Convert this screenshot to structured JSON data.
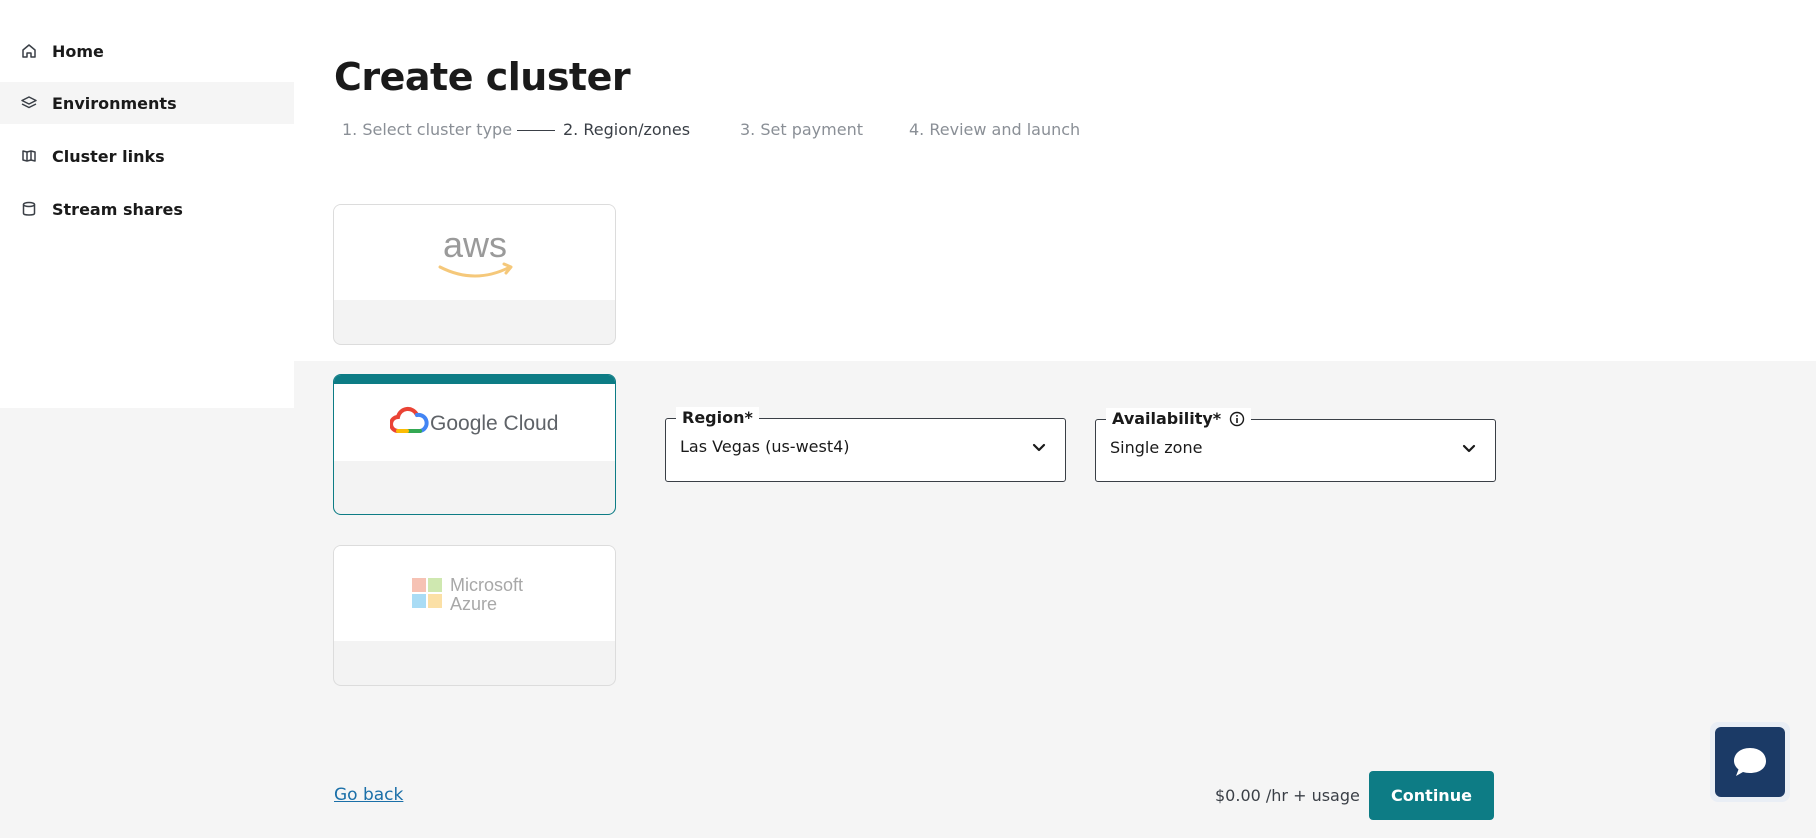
{
  "sidebar": {
    "items": [
      {
        "label": "Home",
        "icon": "home-icon"
      },
      {
        "label": "Environments",
        "icon": "layers-icon",
        "active": true
      },
      {
        "label": "Cluster links",
        "icon": "map-icon"
      },
      {
        "label": "Stream shares",
        "icon": "database-icon"
      }
    ]
  },
  "page": {
    "title": "Create cluster",
    "steps": [
      "1. Select cluster type",
      "2. Region/zones",
      "3. Set payment",
      "4. Review and launch"
    ],
    "current_step": 2
  },
  "providers": [
    {
      "name": "aws",
      "selected": false
    },
    {
      "name": "Google Cloud",
      "selected": true
    },
    {
      "name_line1": "Microsoft",
      "name_line2": "Azure",
      "selected": false
    }
  ],
  "region": {
    "label": "Region*",
    "value": "Las Vegas (us-west4)"
  },
  "availability": {
    "label": "Availability*",
    "value": "Single zone"
  },
  "footer": {
    "go_back": "Go back",
    "price": "$0.00 /hr + usage",
    "continue": "Continue"
  },
  "colors": {
    "accent": "#0d7c85",
    "link": "#1a6fa8",
    "chat": "#1b3a66",
    "background": "#f5f5f5"
  }
}
